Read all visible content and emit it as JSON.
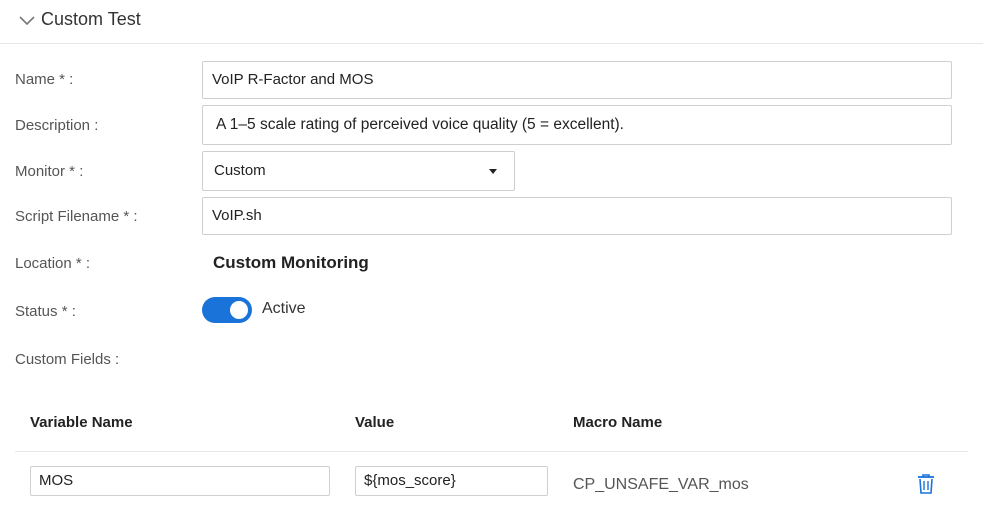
{
  "section": {
    "title": "Custom Test",
    "icon": "chevron-down-icon"
  },
  "form": {
    "name_label": "Name * :",
    "name_value": "VoIP R-Factor and MOS",
    "description_label": "Description :",
    "description_value": "A 1–5 scale rating of perceived voice quality (5 = excellent).",
    "monitor_label": "Monitor * :",
    "monitor_value": "Custom",
    "script_label": "Script Filename * :",
    "script_value": "VoIP.sh",
    "location_label": "Location * :",
    "location_value": "Custom Monitoring",
    "status_label": "Status * :",
    "status_value": "Active",
    "status_on": true,
    "custom_fields_label": "Custom Fields :"
  },
  "custom_fields": {
    "columns": [
      "Variable Name",
      "Value",
      "Macro Name"
    ],
    "rows": [
      {
        "variable": "MOS",
        "value": "${mos_score}",
        "macro": "CP_UNSAFE_VAR_mos",
        "delete_icon": "trash-icon"
      }
    ]
  },
  "colors": {
    "accent": "#1a73d9",
    "border": "#cfcfcf",
    "divider": "#e6e6e6"
  }
}
